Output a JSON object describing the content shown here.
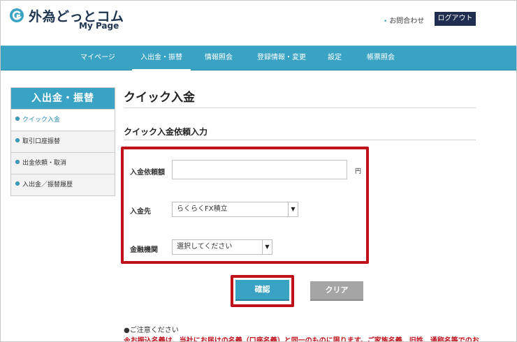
{
  "brand": {
    "name": "外為どっとコム",
    "sub": "My Page",
    "accent": "#3aa3c4",
    "dark": "#1f2d4e",
    "highlight": "#c0111b"
  },
  "header": {
    "inquiry_label": "お問合わせ",
    "logout_label": "ログアウト"
  },
  "nav": {
    "items": [
      {
        "label": "マイページ"
      },
      {
        "label": "入出金・振替",
        "active": true
      },
      {
        "label": "情報照会"
      },
      {
        "label": "登録情報・変更"
      },
      {
        "label": "設定"
      },
      {
        "label": "帳票照会"
      }
    ]
  },
  "sidebar": {
    "title": "入出金・振替",
    "items": [
      {
        "label": "クイック入金",
        "active": true
      },
      {
        "label": "取引口座振替"
      },
      {
        "label": "出金依頼・取消"
      },
      {
        "label": "入出金／振替履歴"
      }
    ]
  },
  "main": {
    "page_title": "クイック入金",
    "section_title": "クイック入金依頼入力",
    "form": {
      "amount_label": "入金依頼額",
      "amount_value": "",
      "amount_unit": "円",
      "destination_label": "入金先",
      "destination_value": "らくらくFX積立",
      "bank_label": "金融機関",
      "bank_value": "選択してください"
    },
    "buttons": {
      "confirm": "確認",
      "clear": "クリア"
    },
    "notice": {
      "title": "●ご注意ください",
      "text": "※お振込名義は、当社にお届けの名義（口座名義）と同一のものに限ります。ご家族名義、旧姓、通称名等でのお"
    }
  }
}
